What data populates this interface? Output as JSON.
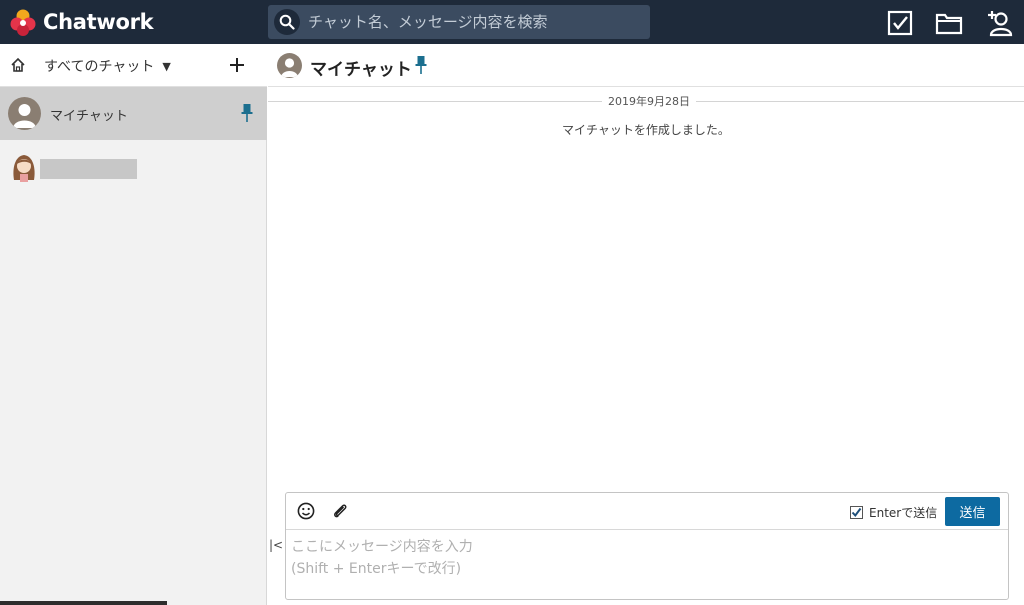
{
  "app": {
    "name": "Chatwork"
  },
  "search": {
    "placeholder": "チャット名、メッセージ内容を検索"
  },
  "topbar": {
    "icons": [
      "task-icon",
      "folder-icon",
      "contact-add-icon"
    ]
  },
  "sidebar": {
    "filter_label": "すべてのチャット",
    "rooms": [
      {
        "name": "マイチャット",
        "pinned": true,
        "active": true
      },
      {
        "name": "",
        "pinned": false,
        "active": false
      }
    ]
  },
  "room": {
    "title": "マイチャット",
    "date": "2019年9月28日",
    "system_message": "マイチャットを作成しました。"
  },
  "composer": {
    "enter_to_send_label": "Enterで送信",
    "enter_to_send_checked": true,
    "send_label": "送信",
    "placeholder": "ここにメッセージ内容を入力\n(Shift + Enterキーで改行)",
    "collapse_label": "|<"
  },
  "colors": {
    "topbar_bg": "#1e2a3a",
    "accent": "#0d6aa1",
    "pin": "#1c6f8f",
    "logo_red": "#e5344a",
    "logo_pink": "#f26a7f"
  }
}
